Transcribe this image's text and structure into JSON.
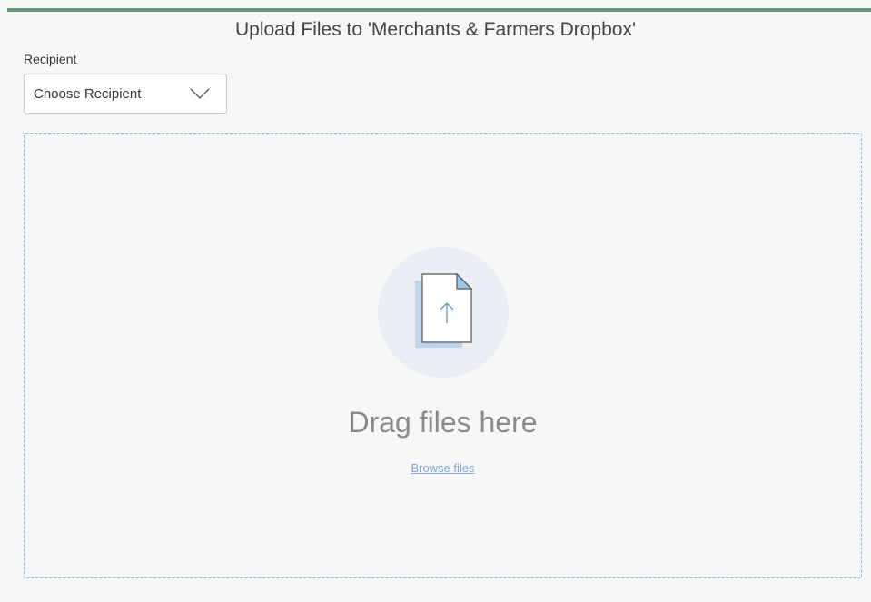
{
  "header": {
    "title": "Upload Files to 'Merchants & Farmers Dropbox'",
    "accent_color": "#5f9678"
  },
  "recipient": {
    "label": "Recipient",
    "selected": "Choose Recipient",
    "icon": "chevron-down-icon"
  },
  "dropzone": {
    "icon": "file-upload-icon",
    "drag_text": "Drag files here",
    "browse_label": "Browse files",
    "border_color": "#8bb3d9",
    "link_color": "#7aa7d6"
  }
}
